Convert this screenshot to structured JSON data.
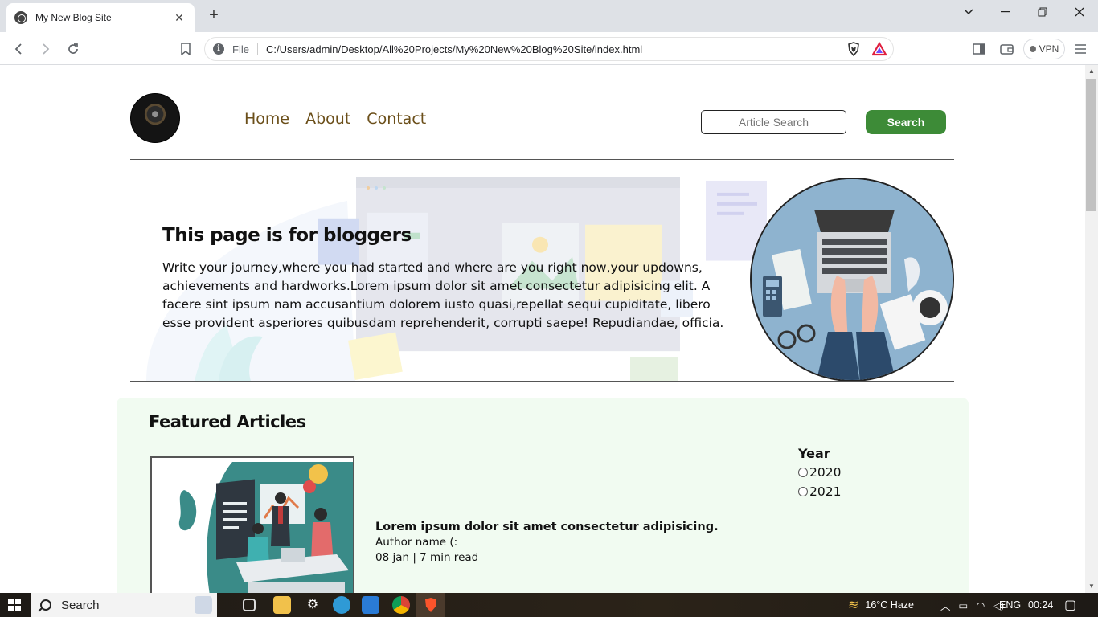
{
  "browser": {
    "tab_title": "My New Blog Site",
    "tab_close": "✕",
    "new_tab": "+",
    "file_label": "File",
    "url": "C:/Users/admin/Desktop/All%20Projects/My%20New%20Blog%20Site/index.html",
    "vpn_label": "VPN"
  },
  "site": {
    "nav": [
      "Home",
      "About",
      "Contact"
    ],
    "search_placeholder": "Article Search",
    "search_button": "Search",
    "hero_title": "This page is for bloggers",
    "hero_text": "Write your journey,where you had started and where are you right now,your updowns, achievements and hardworks.Lorem ipsum dolor sit amet consectetur adipisicing elit. A facere sint ipsum nam accusantium dolorem iusto quasi,repellat sequi cupiditate, libero esse provident asperiores quibusdam reprehenderit, corrupti saepe! Repudiandae, officia.",
    "featured_title": "Featured Articles",
    "article": {
      "title": "Lorem ipsum dolor sit amet consectetur adipisicing.",
      "author": "Author name (:",
      "meta": "08 jan | 7 min read"
    },
    "year_filter": {
      "title": "Year",
      "options": [
        "2020",
        "2021"
      ]
    }
  },
  "taskbar": {
    "search_label": "Search",
    "weather": "16°C  Haze",
    "language": "ENG",
    "time": "00:24"
  },
  "colors": {
    "nav_link": "#6b4f1a",
    "search_button": "#3d8b37",
    "featured_bg": "#f1fbf1"
  }
}
